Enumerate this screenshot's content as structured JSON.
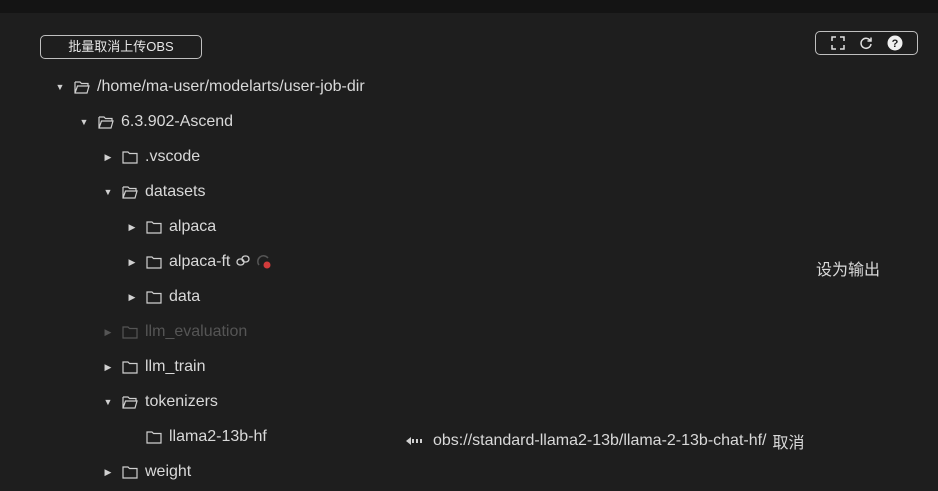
{
  "toolbar": {
    "batch_cancel_label": "批量取消上传OBS"
  },
  "tools": {
    "icons": [
      "fullscreen-icon",
      "refresh-icon",
      "help-icon"
    ]
  },
  "tree": {
    "root": "/home/ma-user/modelarts/user-job-dir",
    "ascend": "6.3.902-Ascend",
    "vscode": ".vscode",
    "datasets": "datasets",
    "alpaca": "alpaca",
    "alpaca_ft": "alpaca-ft",
    "data": "data",
    "llm_evaluation": "llm_evaluation",
    "llm_train": "llm_train",
    "tokenizers": "tokenizers",
    "llama2": "llama2-13b-hf",
    "weight": "weight"
  },
  "actions": {
    "set_output": "设为输出",
    "obs_path": "obs://standard-llama2-13b/llama-2-13b-chat-hf/",
    "cancel": "取消"
  },
  "colors": {
    "background": "#1e1e1e",
    "text": "#d9d9d9",
    "disabled": "#555555",
    "warning": "#d23b3b"
  }
}
